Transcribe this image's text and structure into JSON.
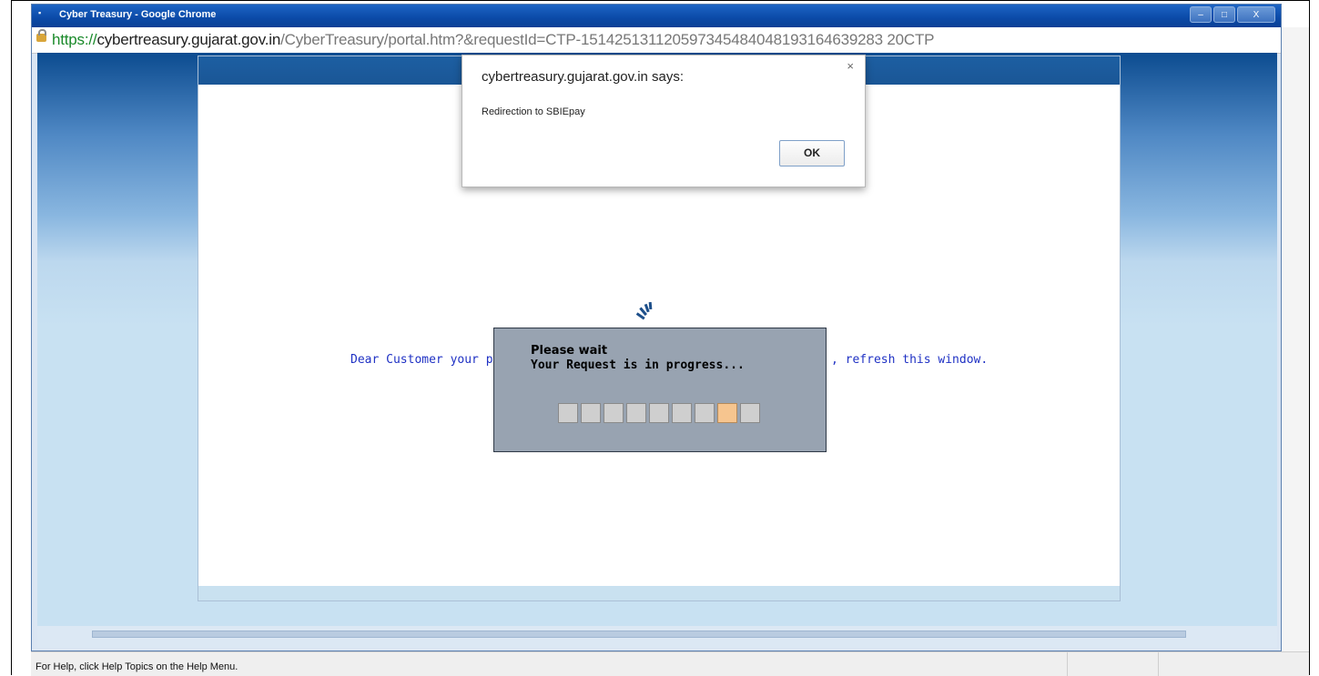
{
  "window": {
    "title": "Cyber Treasury - Google Chrome",
    "controls": {
      "minimize": "–",
      "maximize": "□",
      "close": "X"
    }
  },
  "address_bar": {
    "scheme": "https://",
    "host": "cybertreasury.gujarat.gov.in",
    "path": "/CyberTreasury/portal.htm?&requestId=CTP-151425131120597345484048193164639283 20CTP"
  },
  "page": {
    "message_left": "Dear Customer your pay",
    "message_right": ", refresh this window."
  },
  "wait_dialog": {
    "title": "Please wait",
    "subtitle": "Your Request is in progress...",
    "progress": {
      "total_cells": 9,
      "active_cell": 8
    }
  },
  "alert": {
    "title": "cybertreasury.gujarat.gov.in says:",
    "message": "Redirection to SBIEpay",
    "ok_label": "OK",
    "close_label": "×"
  },
  "status_bar": {
    "text": "For Help, click Help Topics on the Help Menu."
  }
}
